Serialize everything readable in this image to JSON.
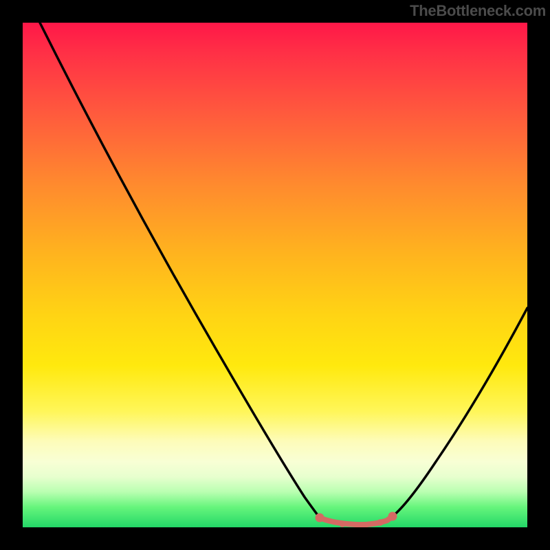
{
  "attribution": "TheBottleneck.com",
  "chart_data": {
    "type": "line",
    "title": "",
    "xlabel": "",
    "ylabel": "",
    "xlim": [
      0,
      100
    ],
    "ylim": [
      0,
      100
    ],
    "notes": "V-shaped valley curve over a vertical red→yellow→green gradient. Axes, ticks, and labels are not rendered in the source image; values below are approximate and read from geometry.",
    "series": [
      {
        "name": "valley-curve",
        "x": [
          3.4,
          10,
          20,
          30,
          40,
          50,
          55,
          58,
          60,
          65,
          70,
          72,
          74,
          80,
          90,
          100
        ],
        "y": [
          100,
          87,
          69,
          51.5,
          34,
          16.5,
          8,
          2.5,
          1,
          0.5,
          0.7,
          1.3,
          3,
          12,
          28,
          44
        ]
      },
      {
        "name": "valley-dots",
        "x": [
          58,
          60,
          63,
          66,
          69,
          72
        ],
        "y": [
          2.5,
          1.3,
          0.8,
          0.7,
          0.9,
          1.6
        ]
      }
    ],
    "colors": {
      "curve": "#000000",
      "dots": "#d46a63",
      "gradient_top": "#ff1748",
      "gradient_mid": "#ffe90e",
      "gradient_bottom": "#23d767"
    }
  }
}
